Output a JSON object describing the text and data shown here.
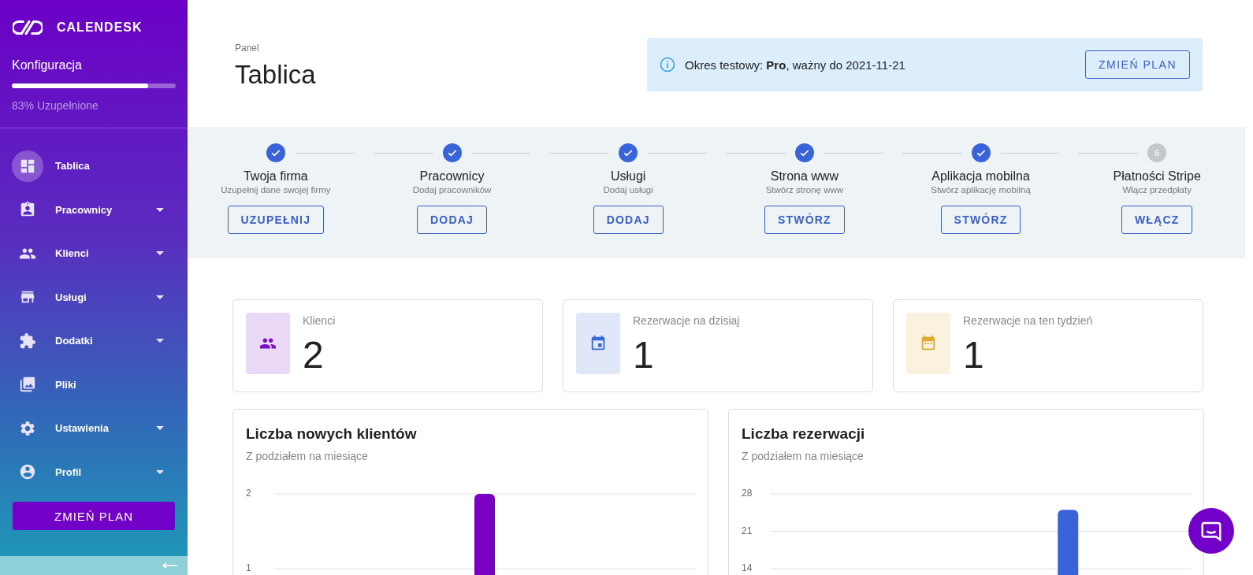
{
  "sidebar": {
    "logo": "CALENDESK",
    "config": {
      "title": "Konfiguracja",
      "level": 0.83,
      "caption": "83% Uzupełnione"
    },
    "items": [
      {
        "kind": "dashboard",
        "label": "Tablica",
        "selected": true,
        "expandable": false
      },
      {
        "kind": "badge",
        "label": "Pracownicy",
        "selected": false,
        "expandable": true
      },
      {
        "kind": "people",
        "label": "Klienci",
        "selected": false,
        "expandable": true
      },
      {
        "kind": "store",
        "label": "Usługi",
        "selected": false,
        "expandable": true
      },
      {
        "kind": "puzzle",
        "label": "Dodatki",
        "selected": false,
        "expandable": true
      },
      {
        "kind": "images",
        "label": "Pliki",
        "selected": false,
        "expandable": false
      },
      {
        "kind": "gear",
        "label": "Ustawienia",
        "selected": false,
        "expandable": true
      },
      {
        "kind": "account",
        "label": "Profil",
        "selected": false,
        "expandable": true
      }
    ],
    "plan_button": "ZMIEŃ PLAN"
  },
  "header": {
    "breadcrumb": "Panel",
    "title": "Tablica"
  },
  "alert": {
    "text": "Okres testowy: **Pro**, ważny do 2021-11-21",
    "button": "ZMIEŃ PLAN"
  },
  "steps": [
    {
      "title": "Twoja firma",
      "subtitle": "Uzupełnij dane swojej firmy",
      "button": "UZUPEŁNIJ",
      "done": true
    },
    {
      "title": "Pracownicy",
      "subtitle": "Dodaj pracowników",
      "button": "DODAJ",
      "done": true
    },
    {
      "title": "Usługi",
      "subtitle": "Dodaj usługi",
      "button": "DODAJ",
      "done": true
    },
    {
      "title": "Strona www",
      "subtitle": "Stwórz stronę www",
      "button": "STWÓRZ",
      "done": true
    },
    {
      "title": "Aplikacja mobilna",
      "subtitle": "Stwórz aplikację mobilną",
      "button": "STWÓRZ",
      "done": true
    },
    {
      "title": "Płatności Stripe",
      "subtitle": "Włącz przedpłaty",
      "button": "WŁĄCZ",
      "done": false,
      "number": "6"
    }
  ],
  "stats": [
    {
      "kind": "people",
      "label": "Klienci",
      "value": "2",
      "color": "#7b10c4"
    },
    {
      "kind": "calendar",
      "label": "Rezerwacje na dzisiaj",
      "value": "1",
      "color": "#3b68d8"
    },
    {
      "kind": "week",
      "label": "Rezerwacje na ten tydzień",
      "value": "1",
      "color": "#e0a82e"
    }
  ],
  "charts": [
    {
      "title": "Liczba nowych klientów",
      "subtitle": "Z podziałem na miesiące",
      "chart_data": {
        "type": "bar",
        "values": [
          null,
          null,
          null,
          2,
          null,
          null,
          null
        ],
        "ylim": [
          0,
          2
        ],
        "yticks": [
          1,
          2
        ]
      }
    },
    {
      "title": "Liczba rezerwacji",
      "subtitle": "Z podziałem na miesiące",
      "chart_data": {
        "type": "bar",
        "values": [
          null,
          null,
          null,
          null,
          null,
          null,
          null,
          null,
          25,
          null,
          null,
          null
        ],
        "ylim": [
          0,
          28
        ],
        "yticks": [
          14,
          21,
          28
        ]
      }
    }
  ]
}
